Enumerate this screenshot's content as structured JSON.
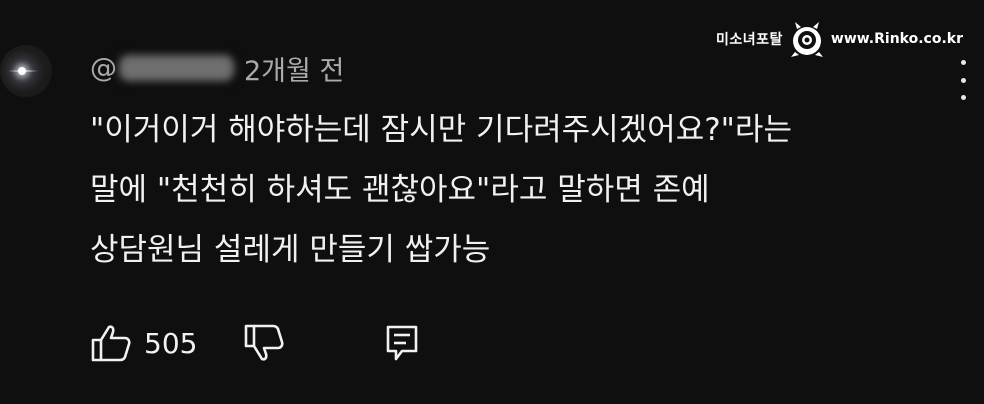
{
  "comment": {
    "handle_prefix": "@",
    "timestamp": "2개월 전",
    "lines": [
      "\"이거이거 해야하는데 잠시만 기다려주시겠어요?\"라는",
      "말에 \"천천히 하셔도 괜찮아요\"라고 말하면 존예",
      "상담원님 설레게 만들기 쌉가능"
    ],
    "like_count": "505"
  },
  "watermark": {
    "left_text": "미소녀포탈",
    "right_text": "www.Rinko.co.kr"
  },
  "icons": {
    "menu": "more-vert-icon",
    "like": "thumbs-up-icon",
    "dislike": "thumbs-down-icon",
    "reply": "comment-reply-icon"
  }
}
